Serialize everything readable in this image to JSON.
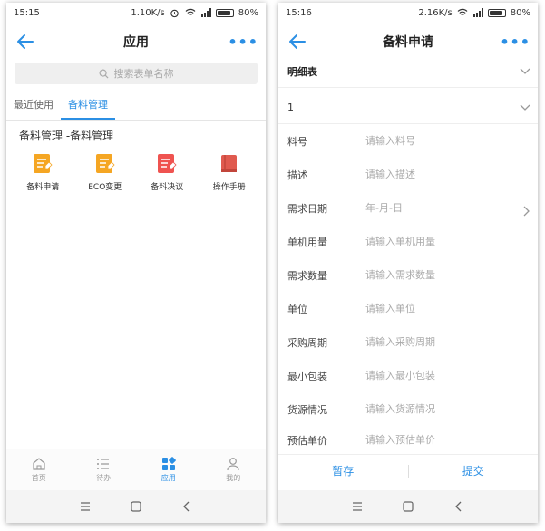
{
  "left": {
    "status": {
      "time": "15:15",
      "speed": "1.10K/s",
      "battery": "80%"
    },
    "nav": {
      "title": "应用",
      "more": "•••"
    },
    "search": {
      "placeholder": "搜索表单名称"
    },
    "tabs": [
      {
        "label": "最近使用"
      },
      {
        "label": "备料管理"
      }
    ],
    "group_title": "备料管理 -备料管理",
    "apps": [
      {
        "label": "备料申请",
        "icon": "form-doc-icon",
        "color": "#f5a623"
      },
      {
        "label": "ECO变更",
        "icon": "form-doc-icon",
        "color": "#f5a623"
      },
      {
        "label": "备料决议",
        "icon": "form-doc-icon",
        "color": "#ef5350"
      },
      {
        "label": "操作手册",
        "icon": "book-icon",
        "color": "#e05a4f"
      }
    ],
    "tabbar": [
      {
        "label": "首页",
        "icon": "home-icon"
      },
      {
        "label": "待办",
        "icon": "todo-list-icon"
      },
      {
        "label": "应用",
        "icon": "apps-grid-icon"
      },
      {
        "label": "我的",
        "icon": "user-icon"
      }
    ]
  },
  "right": {
    "status": {
      "time": "15:16",
      "speed": "2.16K/s",
      "battery": "80%"
    },
    "nav": {
      "title": "备料申请",
      "more": "•••"
    },
    "detail_section": {
      "label": "明细表"
    },
    "item_section": {
      "label": "1"
    },
    "fields": [
      {
        "label": "料号",
        "placeholder": "请输入料号"
      },
      {
        "label": "描述",
        "placeholder": "请输入描述"
      },
      {
        "label": "需求日期",
        "placeholder": "年-月-日"
      },
      {
        "label": "单机用量",
        "placeholder": "请输入单机用量"
      },
      {
        "label": "需求数量",
        "placeholder": "请输入需求数量"
      },
      {
        "label": "单位",
        "placeholder": "请输入单位"
      },
      {
        "label": "采购周期",
        "placeholder": "请输入采购周期"
      },
      {
        "label": "最小包装",
        "placeholder": "请输入最小包装"
      },
      {
        "label": "货源情况",
        "placeholder": "请输入货源情况"
      },
      {
        "label": "预估单价",
        "placeholder": "请输入预估单价"
      }
    ],
    "actions": {
      "save": "暂存",
      "submit": "提交"
    }
  },
  "colors": {
    "accent": "#2b8fe4",
    "orange": "#f5a623",
    "red": "#ef5350"
  }
}
